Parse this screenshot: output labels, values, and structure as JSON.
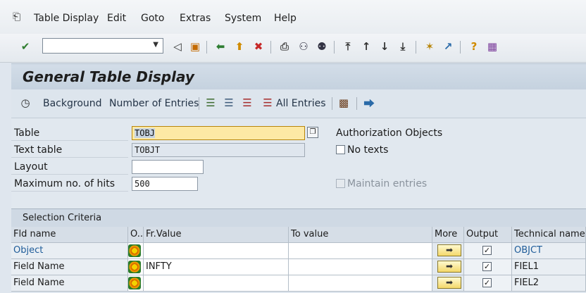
{
  "menubar": {
    "items": [
      "Table Display",
      "Edit",
      "Goto",
      "Extras",
      "System",
      "Help"
    ]
  },
  "toolbar": {
    "command_value": ""
  },
  "header": {
    "title": "General Table Display"
  },
  "app_toolbar": {
    "background_label": "Background",
    "number_of_entries_label": "Number of Entries",
    "all_entries_label": "All Entries"
  },
  "form": {
    "table_label": "Table",
    "table_value": "TOBJ",
    "text_table_label": "Text table",
    "text_table_value": "TOBJT",
    "layout_label": "Layout",
    "layout_value": "",
    "max_hits_label": "Maximum no. of hits",
    "max_hits_value": "500",
    "authorization_objects_label": "Authorization Objects",
    "no_texts_label": "No texts",
    "maintain_entries_label": "Maintain entries"
  },
  "selection": {
    "header": "Selection Criteria",
    "columns": {
      "fld_name": "Fld name",
      "o": "O..",
      "fr_value": "Fr.Value",
      "to_value": "To value",
      "more": "More",
      "output": "Output",
      "technical_name": "Technical name"
    },
    "rows": [
      {
        "fld_name": "Object",
        "fr_value": "",
        "to_value": "",
        "output_checked": "✓",
        "technical_name": "OBJCT"
      },
      {
        "fld_name": "Field Name",
        "fr_value": "INFTY",
        "to_value": "",
        "output_checked": "✓",
        "technical_name": "FIEL1"
      },
      {
        "fld_name": "Field Name",
        "fr_value": "",
        "to_value": "",
        "output_checked": "✓",
        "technical_name": "FIEL2"
      }
    ]
  }
}
